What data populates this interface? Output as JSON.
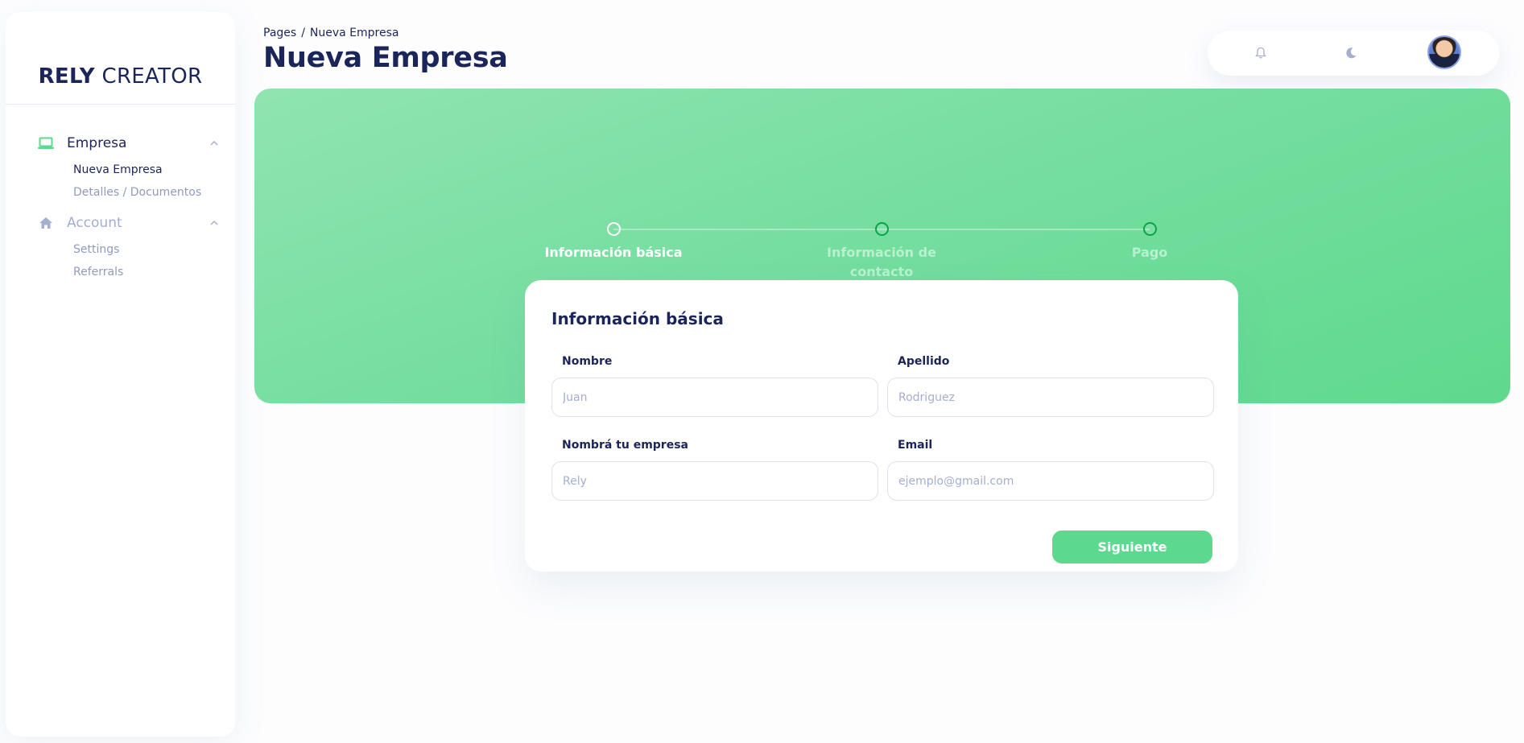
{
  "brand": {
    "bold": "RELY",
    "light": "CREATOR"
  },
  "sidebar": {
    "groups": [
      {
        "label": "Empresa",
        "icon": "laptop-icon",
        "items": [
          "Nueva Empresa",
          "Detalles / Documentos"
        ]
      },
      {
        "label": "Account",
        "icon": "home-icon",
        "items": [
          "Settings",
          "Referrals"
        ]
      }
    ]
  },
  "header": {
    "breadcrumb": [
      "Pages",
      "Nueva Empresa"
    ],
    "separator": "/",
    "title": "Nueva Empresa"
  },
  "topbar": {
    "icons": [
      "bell-icon",
      "moon-icon"
    ],
    "avatar": "user-avatar"
  },
  "stepper": {
    "steps": [
      {
        "label": "Información básica",
        "state": "active"
      },
      {
        "label": "Información de contacto",
        "state": "pending"
      },
      {
        "label": "Pago",
        "state": "pending"
      }
    ]
  },
  "form": {
    "title": "Información básica",
    "fields": {
      "nombre": {
        "label": "Nombre",
        "placeholder": "Juan",
        "value": ""
      },
      "apellido": {
        "label": "Apellido",
        "placeholder": "Rodriguez",
        "value": ""
      },
      "empresa": {
        "label": "Nombrá tu empresa",
        "placeholder": "Rely",
        "value": ""
      },
      "email": {
        "label": "Email",
        "placeholder": "ejemplo@gmail.com",
        "value": ""
      }
    },
    "submit_label": "Siguiente"
  },
  "colors": {
    "accent": "#5cd98f",
    "text_primary": "#1b2559",
    "text_secondary": "#a3aed0",
    "step_pending": "#0aa44b"
  }
}
